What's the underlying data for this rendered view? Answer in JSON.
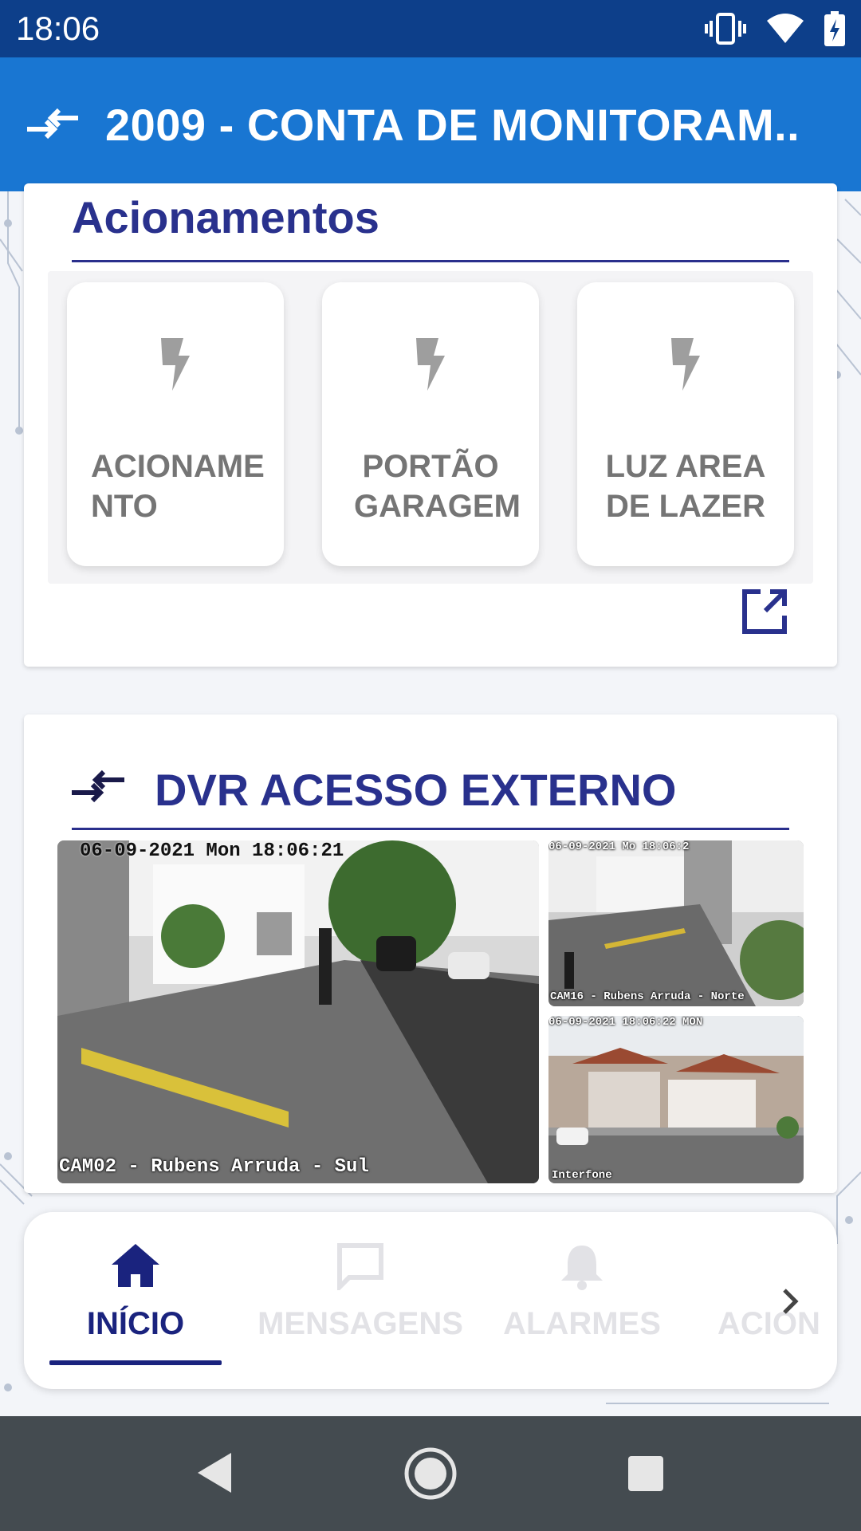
{
  "status_bar": {
    "time": "18:06",
    "icons": [
      "vibrate-icon",
      "wifi-icon",
      "battery-charging-icon"
    ]
  },
  "app_bar": {
    "title": "2009 - CONTA DE MONITORAM..",
    "icon": "swap-arrows-icon"
  },
  "acionamentos": {
    "title": "Acionamentos",
    "tiles": [
      {
        "label": "ACIONAME NTO",
        "icon": "bolt-icon"
      },
      {
        "label": "PORTÃO GARAGEM",
        "icon": "bolt-icon"
      },
      {
        "label": "LUZ AREA DE LAZER",
        "icon": "bolt-icon"
      }
    ],
    "open_icon": "open-in-new-icon"
  },
  "dvr": {
    "title": "DVR ACESSO EXTERNO",
    "icon": "swap-arrows-icon",
    "cameras": [
      {
        "timestamp": "06-09-2021 Mon 18:06:21",
        "caption": "CAM02 - Rubens Arruda - Sul"
      },
      {
        "timestamp": "06-09-2021 Mo 18:06:2",
        "caption": "CAM16 - Rubens Arruda - Norte"
      },
      {
        "timestamp": "06-09-2021 18:06:22 MON",
        "caption": "Interfone"
      }
    ]
  },
  "bottom_nav": {
    "items": [
      {
        "label": "INÍCIO",
        "icon": "home-icon",
        "active": true
      },
      {
        "label": "MENSAGENS",
        "icon": "message-icon",
        "active": false
      },
      {
        "label": "ALARMES",
        "icon": "bell-icon",
        "active": false
      },
      {
        "label": "ACION",
        "icon": "bolt-icon",
        "active": false
      }
    ],
    "more_icon": "chevron-right-icon"
  },
  "colors": {
    "status_bar": "#0d3f8a",
    "app_bar": "#1976d2",
    "title_blue": "#29318d",
    "active_nav": "#1a237e",
    "system_nav": "#444b50"
  }
}
